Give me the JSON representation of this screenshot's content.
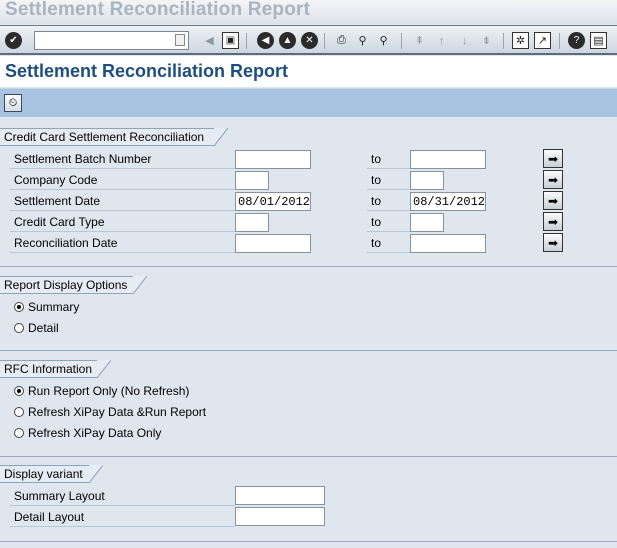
{
  "window": {
    "title": "Settlement Reconciliation Report"
  },
  "toolbar": {
    "command_value": "",
    "icons": [
      "enter-icon",
      "back-arrow-icon",
      "save-icon",
      "back-icon",
      "exit-icon",
      "cancel-icon",
      "print-icon",
      "find-icon",
      "find-next-icon",
      "first-page-icon",
      "previous-page-icon",
      "next-page-icon",
      "last-page-icon",
      "new-session-icon",
      "shortcut-icon",
      "help-icon",
      "layout-icon"
    ]
  },
  "header": {
    "title": "Settlement Reconciliation Report"
  },
  "appbar": {
    "execute_icon": "execute-clock-icon"
  },
  "selection": {
    "title": "Credit Card Settlement Reconciliation",
    "to_label": "to",
    "rows": [
      {
        "label": "Settlement Batch Number",
        "from": "",
        "to": ""
      },
      {
        "label": "Company Code",
        "from": "",
        "to": ""
      },
      {
        "label": "Settlement Date",
        "from": "08/01/2012",
        "to": "08/31/2012"
      },
      {
        "label": "Credit Card Type",
        "from": "",
        "to": ""
      },
      {
        "label": "Reconciliation Date",
        "from": "",
        "to": ""
      }
    ]
  },
  "display_options": {
    "title": "Report Display Options",
    "options": [
      {
        "label": "Summary",
        "selected": true
      },
      {
        "label": "Detail",
        "selected": false
      }
    ]
  },
  "rfc": {
    "title": "RFC Information",
    "options": [
      {
        "label": "Run Report Only (No Refresh)",
        "selected": true
      },
      {
        "label": "Refresh XiPay Data &Run Report",
        "selected": false
      },
      {
        "label": "Refresh XiPay Data Only",
        "selected": false
      }
    ]
  },
  "variant": {
    "title": "Display variant",
    "rows": [
      {
        "label": "Summary Layout",
        "value": ""
      },
      {
        "label": "Detail Layout",
        "value": ""
      }
    ]
  },
  "colors": {
    "header_text": "#1d4e7f",
    "appbar": "#a9c4e1",
    "background": "#dfe6ee"
  }
}
